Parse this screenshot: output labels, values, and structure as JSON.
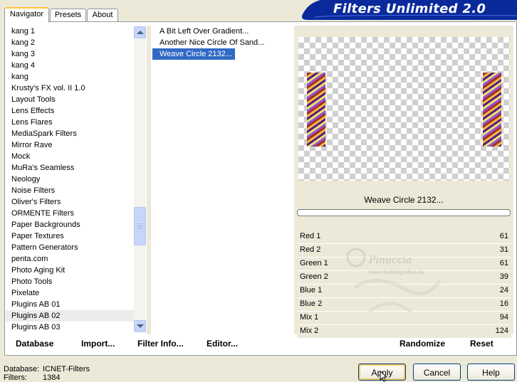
{
  "banner": {
    "title": "Filters Unlimited 2.0"
  },
  "tabs": [
    {
      "label": "Navigator",
      "active": true
    },
    {
      "label": "Presets",
      "active": false
    },
    {
      "label": "About",
      "active": false
    }
  ],
  "categories": [
    "kang 1",
    "kang 2",
    "kang 3",
    "kang 4",
    "kang",
    "Krusty's FX vol. II 1.0",
    "Layout Tools",
    "Lens Effects",
    "Lens Flares",
    "MediaSpark Filters",
    "Mirror Rave",
    "Mock",
    "MuRa's Seamless",
    "Neology",
    "Noise Filters",
    "Oliver's Filters",
    "ORMENTE Filters",
    "Paper Backgrounds",
    "Paper Textures",
    "Pattern Generators",
    "penta.com",
    "Photo Aging Kit",
    "Photo Tools",
    "Pixelate",
    "Plugins AB 01",
    "Plugins AB 02",
    "Plugins AB 03"
  ],
  "selected_category": "Plugins AB 02",
  "filters": [
    "A Bit Left Over Gradient...",
    "Another Nice Circle Of Sand...",
    "Weave Circle 2132..."
  ],
  "selected_filter": "Weave Circle 2132...",
  "preview": {
    "label": "Weave Circle 2132..."
  },
  "sliders": [
    {
      "name": "Red 1",
      "value": "61"
    },
    {
      "name": "Red 2",
      "value": "31"
    },
    {
      "name": "Green 1",
      "value": "61"
    },
    {
      "name": "Green 2",
      "value": "39"
    },
    {
      "name": "Blue 1",
      "value": "24"
    },
    {
      "name": "Blue 2",
      "value": "16"
    },
    {
      "name": "Mix 1",
      "value": "94"
    },
    {
      "name": "Mix 2",
      "value": "124"
    }
  ],
  "watermark": {
    "name": "Pinuccia",
    "site": "www.mafilmgrafica.eu"
  },
  "toolbar": {
    "database": "Database",
    "import": "Import...",
    "filter_info": "Filter Info...",
    "editor": "Editor...",
    "randomize": "Randomize",
    "reset": "Reset"
  },
  "footer": {
    "database_label": "Database:",
    "database_value": "ICNET-Filters",
    "filters_label": "Filters:",
    "filters_value": "1384",
    "apply": "Apply",
    "cancel": "Cancel",
    "help": "Help"
  },
  "colors": {
    "selection": "#316ac5",
    "banner": "#0a2a9c",
    "tab_highlight": "#ffc83c"
  }
}
